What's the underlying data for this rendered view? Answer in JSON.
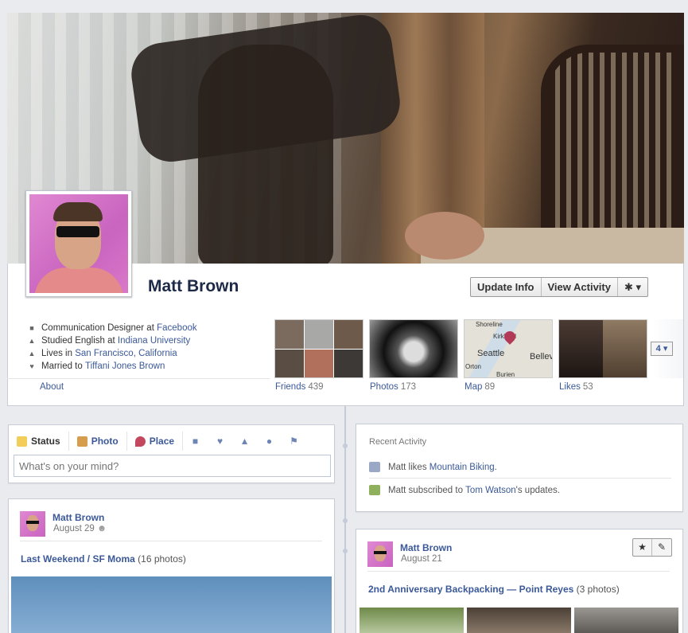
{
  "profile": {
    "name": "Matt Brown",
    "about_label": "About"
  },
  "actions": {
    "update_info": "Update Info",
    "view_activity": "View Activity",
    "gear_menu": "✱ ▾"
  },
  "info": [
    {
      "icon": "briefcase-icon",
      "glyph": "■",
      "text": "Communication Designer at ",
      "link": "Facebook"
    },
    {
      "icon": "graduation-cap-icon",
      "glyph": "▲",
      "text": "Studied English at ",
      "link": "Indiana University"
    },
    {
      "icon": "house-icon",
      "glyph": "▲",
      "text": "Lives in ",
      "link": "San Francisco, California"
    },
    {
      "icon": "heart-icon",
      "glyph": "♥",
      "text": "Married to ",
      "link": "Tiffani Jones Brown"
    }
  ],
  "tiles": {
    "friends": {
      "label": "Friends",
      "count": "439"
    },
    "photos": {
      "label": "Photos",
      "count": "173"
    },
    "map": {
      "label": "Map",
      "count": "89",
      "places": [
        "Shoreline",
        "Kirkland",
        "Seattle",
        "Bellevue",
        "Burien",
        "Orton"
      ]
    },
    "likes": {
      "label": "Likes",
      "count": "53"
    },
    "more": "4 ▾"
  },
  "composer": {
    "tabs": [
      "Status",
      "Photo",
      "Place"
    ],
    "placeholder": "What's on your mind?"
  },
  "recent_activity": {
    "title": "Recent Activity",
    "items": [
      {
        "prefix": "Matt likes ",
        "link": "Mountain Biking",
        "suffix": "."
      },
      {
        "prefix": "Matt subscribed to ",
        "link": "Tom Watson",
        "suffix": "'s updates."
      }
    ]
  },
  "stories": [
    {
      "author": "Matt Brown",
      "date": "August 29",
      "title": "Last Weekend / SF Moma",
      "photo_count": "(16 photos)"
    },
    {
      "author": "Matt Brown",
      "date": "August 21",
      "title": "2nd Anniversary Backpacking — Point Reyes",
      "photo_count": "(3 photos)"
    }
  ],
  "colors": {
    "link": "#3b5998",
    "timeline_line": "#c5cbd8"
  }
}
